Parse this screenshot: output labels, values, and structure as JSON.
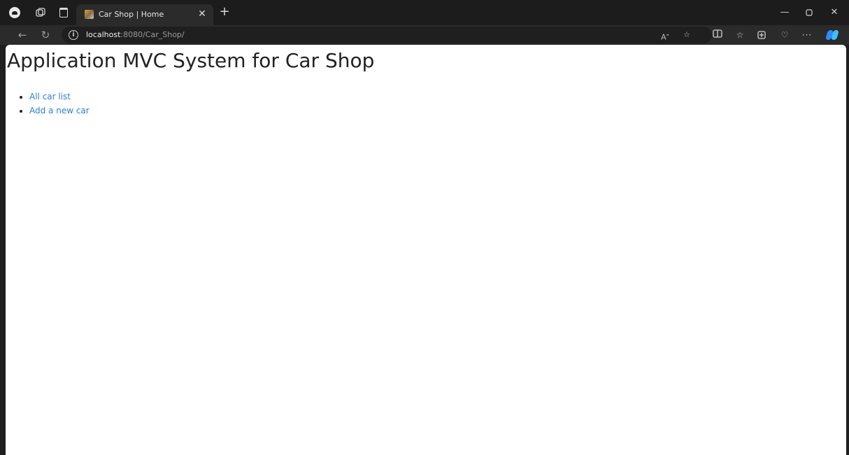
{
  "browser": {
    "tab": {
      "title": "Car Shop | Home"
    },
    "address": {
      "host": "localhost",
      "path": ":8080/Car_Shop/"
    }
  },
  "page": {
    "title": "Application MVC System for Car Shop",
    "links": [
      {
        "label": "All car list"
      },
      {
        "label": "Add a new car"
      }
    ]
  },
  "colors": {
    "chrome_bg": "#1f1f1f",
    "toolbar_bg": "#2b2b2b",
    "page_bg": "#ffffff",
    "link": "#2b7fd8",
    "heading": "#222222"
  },
  "icons": [
    "profile-icon",
    "workspaces-icon",
    "tab-actions-icon",
    "favicon",
    "close-tab-icon",
    "new-tab-icon",
    "minimize-icon",
    "restore-icon",
    "close-window-icon",
    "back-icon",
    "refresh-icon",
    "site-info-icon",
    "read-aloud-icon",
    "favorite-star-icon",
    "split-screen-icon",
    "favorites-icon",
    "collections-icon",
    "browser-essentials-icon",
    "more-icon",
    "copilot-icon"
  ]
}
